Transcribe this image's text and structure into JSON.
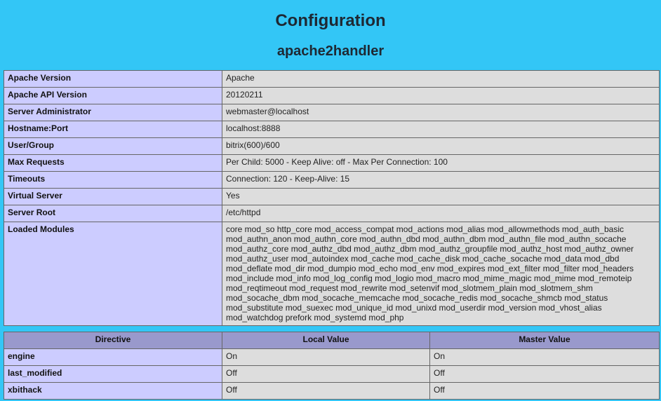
{
  "page": {
    "title": "Configuration",
    "subtitle": "apache2handler"
  },
  "info_rows": [
    {
      "key": "Apache Version",
      "value": "Apache"
    },
    {
      "key": "Apache API Version",
      "value": "20120211"
    },
    {
      "key": "Server Administrator",
      "value": "webmaster@localhost"
    },
    {
      "key": "Hostname:Port",
      "value": "localhost:8888"
    },
    {
      "key": "User/Group",
      "value": "bitrix(600)/600"
    },
    {
      "key": "Max Requests",
      "value": "Per Child: 5000 - Keep Alive: off - Max Per Connection: 100"
    },
    {
      "key": "Timeouts",
      "value": "Connection: 120 - Keep-Alive: 15"
    },
    {
      "key": "Virtual Server",
      "value": "Yes"
    },
    {
      "key": "Server Root",
      "value": "/etc/httpd"
    },
    {
      "key": "Loaded Modules",
      "value": "core mod_so http_core mod_access_compat mod_actions mod_alias mod_allowmethods mod_auth_basic mod_authn_anon mod_authn_core mod_authn_dbd mod_authn_dbm mod_authn_file mod_authn_socache mod_authz_core mod_authz_dbd mod_authz_dbm mod_authz_groupfile mod_authz_host mod_authz_owner mod_authz_user mod_autoindex mod_cache mod_cache_disk mod_cache_socache mod_data mod_dbd mod_deflate mod_dir mod_dumpio mod_echo mod_env mod_expires mod_ext_filter mod_filter mod_headers mod_include mod_info mod_log_config mod_logio mod_macro mod_mime_magic mod_mime mod_remoteip mod_reqtimeout mod_request mod_rewrite mod_setenvif mod_slotmem_plain mod_slotmem_shm mod_socache_dbm mod_socache_memcache mod_socache_redis mod_socache_shmcb mod_status mod_substitute mod_suexec mod_unique_id mod_unixd mod_userdir mod_version mod_vhost_alias mod_watchdog prefork mod_systemd mod_php"
    }
  ],
  "directives": {
    "headers": [
      "Directive",
      "Local Value",
      "Master Value"
    ],
    "rows": [
      {
        "directive": "engine",
        "local": "On",
        "master": "On"
      },
      {
        "directive": "last_modified",
        "local": "Off",
        "master": "Off"
      },
      {
        "directive": "xbithack",
        "local": "Off",
        "master": "Off"
      }
    ]
  },
  "colors": {
    "background": "#33c6f6",
    "key_cell": "#ccccff",
    "value_cell": "#dddddd",
    "header_cell": "#9999cc"
  }
}
